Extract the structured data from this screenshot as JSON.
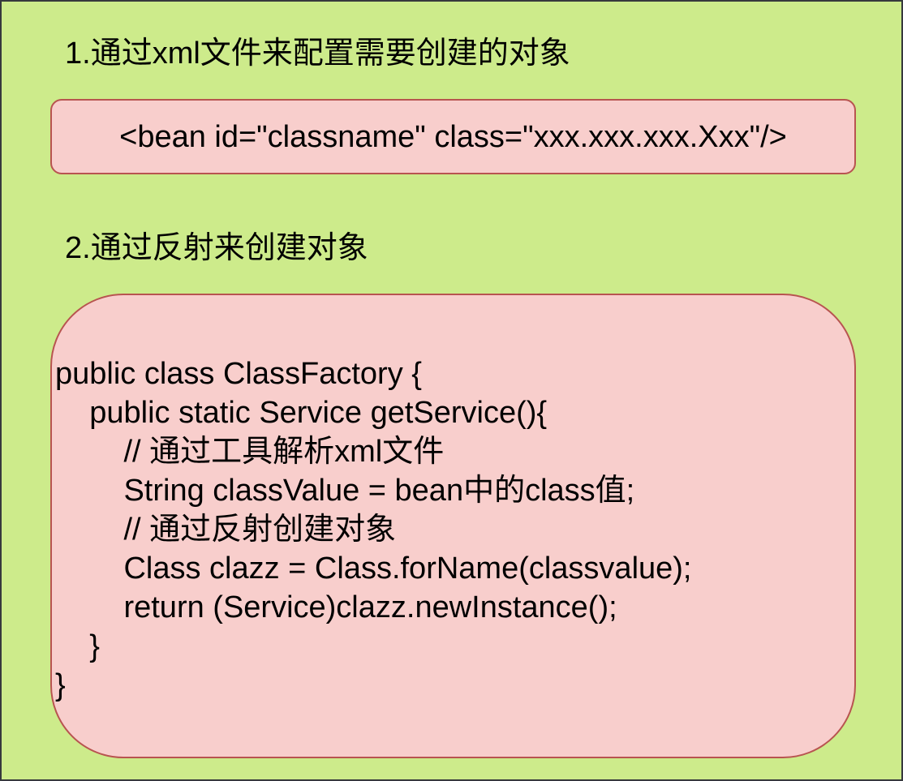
{
  "headings": {
    "step1": "1.通过xml文件来配置需要创建的对象",
    "step2": "2.通过反射来创建对象"
  },
  "bean_config": "<bean id=\"classname\" class=\"xxx.xxx.xxx.Xxx\"/>",
  "code_lines": [
    "public class ClassFactory {",
    "    public static Service getService(){",
    "        // 通过工具解析xml文件",
    "        String classValue = bean中的class值;",
    "        // 通过反射创建对象",
    "        Class clazz = Class.forName(classvalue);",
    "        return (Service)clazz.newInstance();",
    "    }",
    "}"
  ],
  "colors": {
    "background": "#cdeb8b",
    "box_fill": "#f8cecc",
    "box_border": "#b85450",
    "outer_border": "#36393d"
  }
}
